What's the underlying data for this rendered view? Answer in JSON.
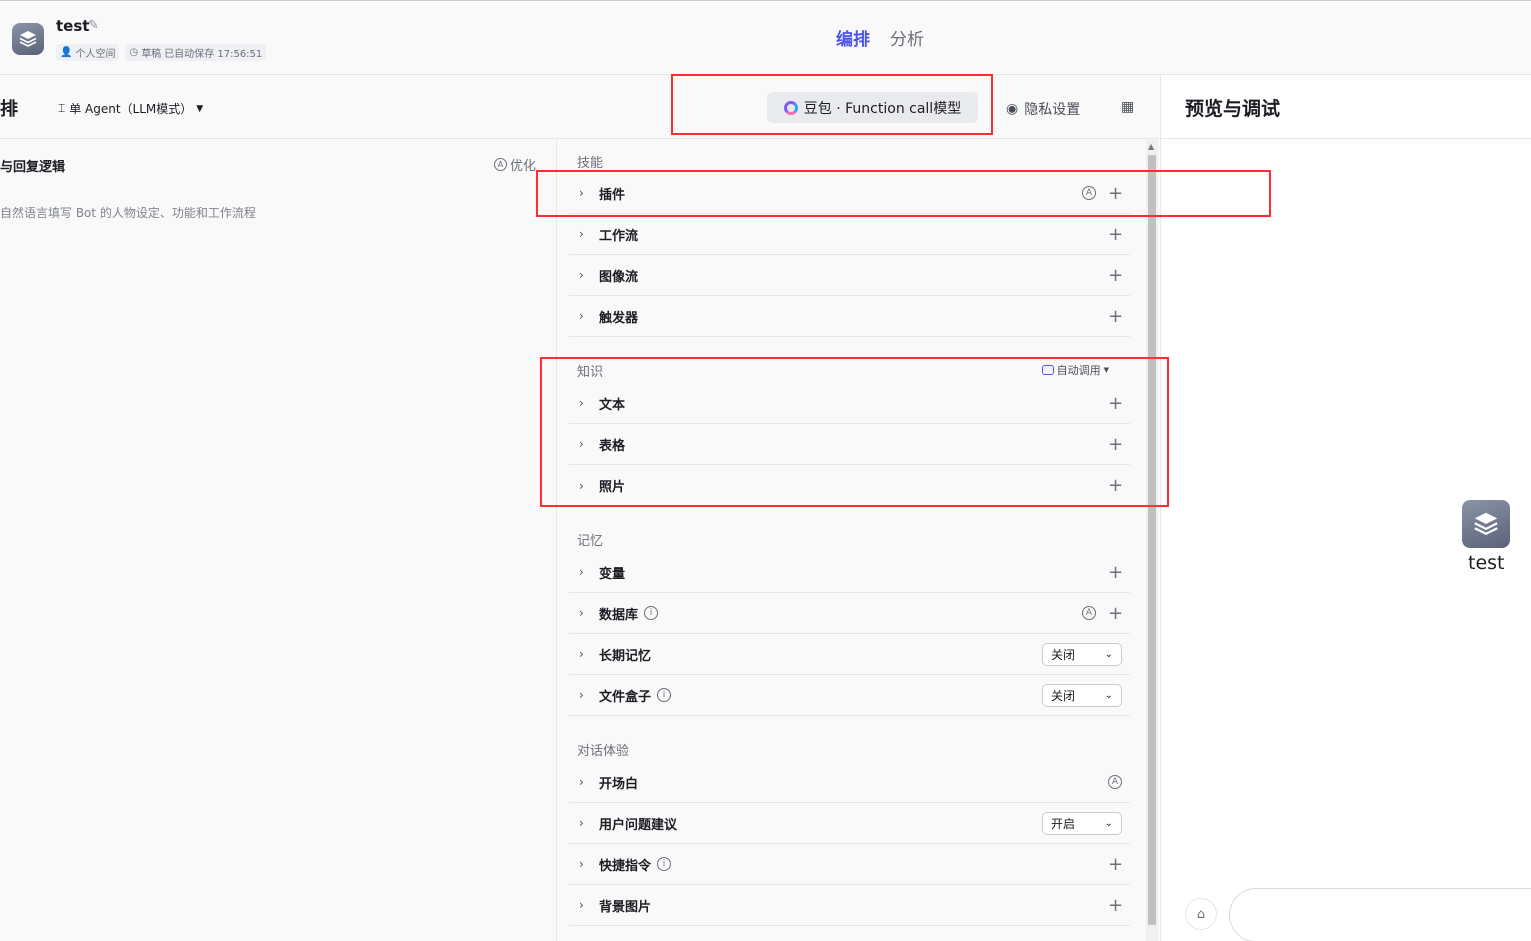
{
  "header": {
    "bot_name": "test",
    "space": "个人空间",
    "status": "草稿",
    "autosave": "已自动保存 17:56:51",
    "tabs": [
      "编排",
      "分析"
    ]
  },
  "left": {
    "title": "排",
    "agent_mode": "单 Agent（LLM模式）",
    "model": "豆包 · Function call模型",
    "privacy": "隐私设置",
    "prompt_title": "与回复逻辑",
    "optimize": "优化",
    "prompt_hint": "自然语言填写 Bot 的人物设定、功能和工作流程"
  },
  "skills": {
    "label": "技能",
    "items": [
      "插件",
      "工作流",
      "图像流",
      "触发器"
    ]
  },
  "knowledge": {
    "label": "知识",
    "auto_call": "自动调用",
    "items": [
      "文本",
      "表格",
      "照片"
    ]
  },
  "memory": {
    "label": "记忆",
    "items": [
      "变量",
      "数据库",
      "长期记忆",
      "文件盒子"
    ],
    "long_term_value": "关闭",
    "file_box_value": "关闭"
  },
  "experience": {
    "label": "对话体验",
    "items": [
      "开场白",
      "用户问题建议",
      "快捷指令",
      "背景图片"
    ],
    "suggest_value": "开启"
  },
  "preview": {
    "title": "预览与调试",
    "bot_name": "test"
  },
  "colors": {
    "accent": "#4d53e8",
    "highlight": "#ff2d2d"
  }
}
